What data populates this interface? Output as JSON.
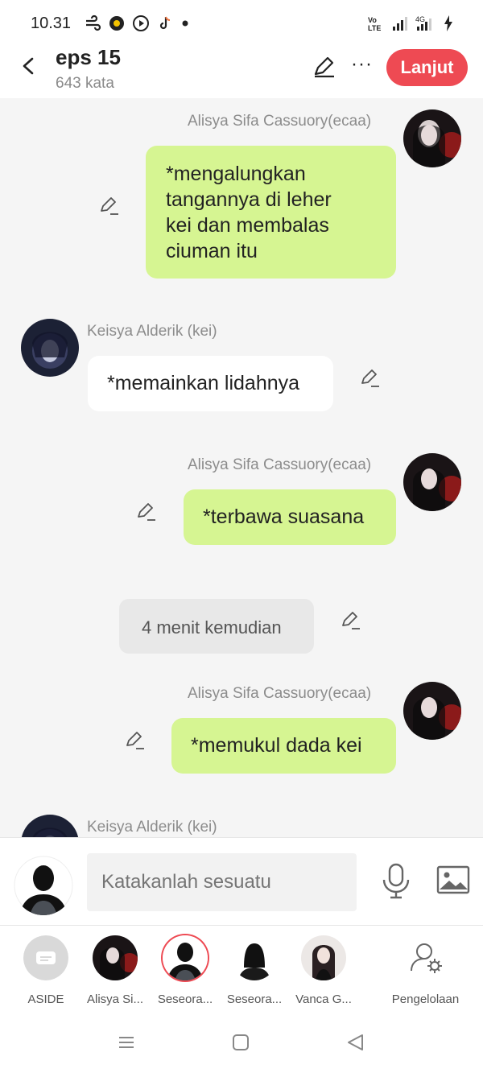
{
  "status": {
    "time": "10.31",
    "network": "4G",
    "volte": "Vo LTE"
  },
  "header": {
    "title": "eps 15",
    "word_count": "643 kata",
    "next_label": "Lanjut",
    "more_label": "···"
  },
  "messages": [
    {
      "speaker": "Alisya Sifa Cassuory(ecaa)",
      "text_lines": [
        "*mengalungkan",
        "tangannya di leher",
        "kei dan membalas",
        "ciuman itu"
      ]
    },
    {
      "speaker": "Keisya Alderik (kei)",
      "text": "*memainkan lidahnya"
    },
    {
      "speaker": "Alisya Sifa Cassuory(ecaa)",
      "text": "*terbawa suasana"
    },
    {
      "narration": "4 menit kemudian"
    },
    {
      "speaker": "Alisya Sifa Cassuory(ecaa)",
      "text": "*memukul dada kei"
    },
    {
      "speaker": "Keisya Alderik (kei)"
    }
  ],
  "input": {
    "placeholder": "Katakanlah sesuatu"
  },
  "characters": [
    {
      "label": "ASIDE"
    },
    {
      "label": "Alisya Si..."
    },
    {
      "label": "Seseora..."
    },
    {
      "label": "Seseora..."
    },
    {
      "label": "Vanca G..."
    },
    {
      "label": "Pengelolaan"
    }
  ],
  "colors": {
    "accent": "#ee4a53",
    "my_bubble": "#d6f592",
    "other_bubble": "#ffffff",
    "chat_bg": "#f5f5f5"
  }
}
